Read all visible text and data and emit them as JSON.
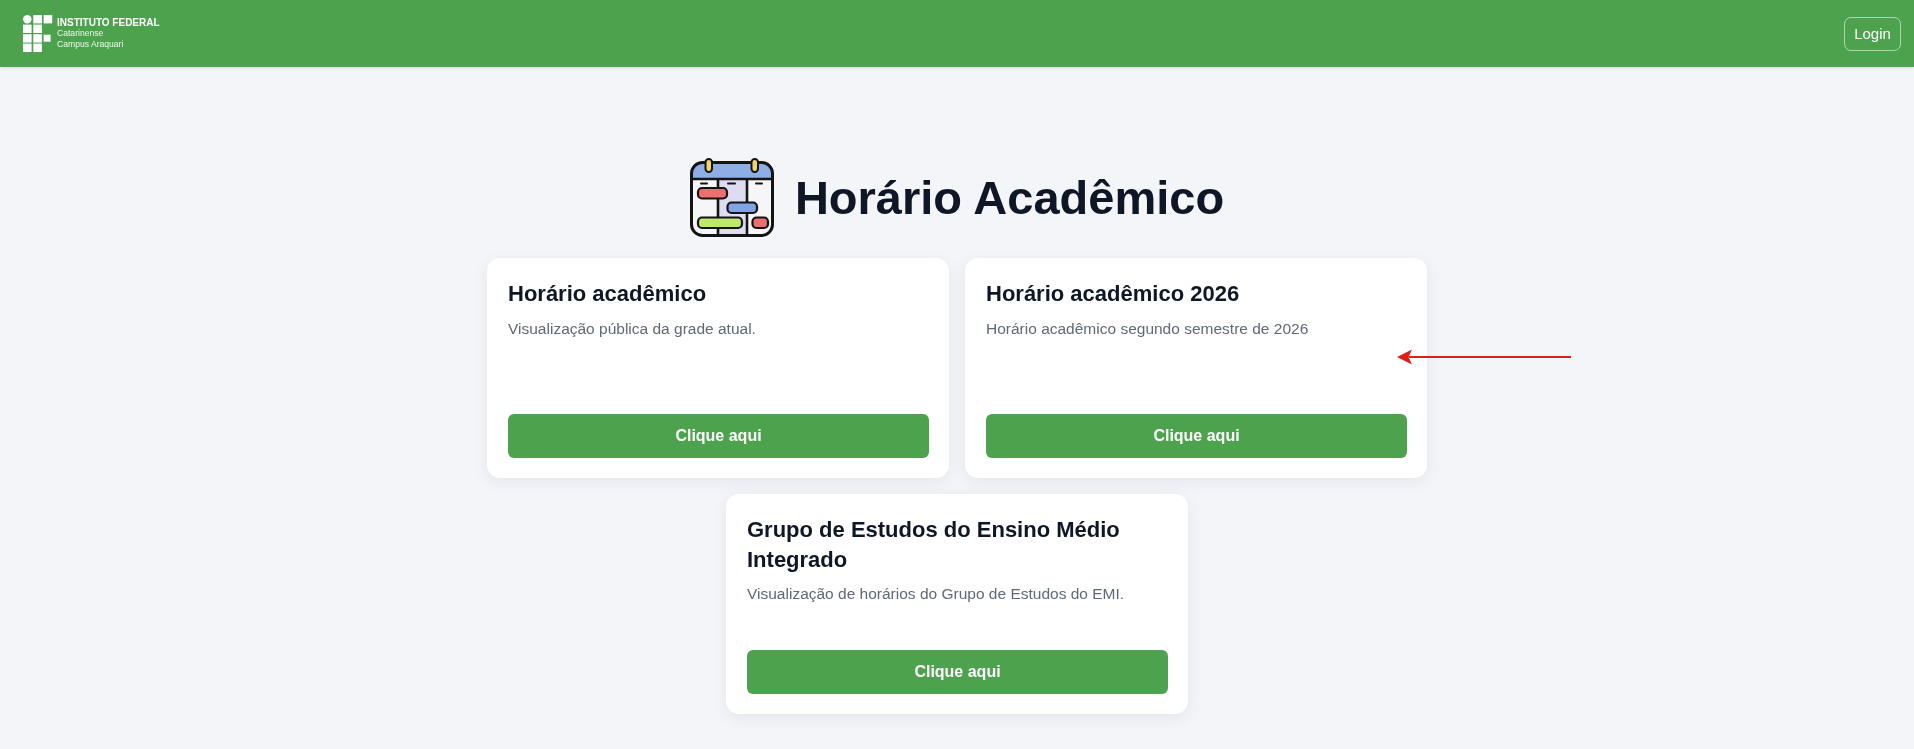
{
  "header": {
    "logo": {
      "name": "INSTITUTO FEDERAL",
      "lines": [
        "Catarinense",
        "Campus Araquari"
      ]
    },
    "login_button": "Login"
  },
  "hero": {
    "title": "Horário Acadêmico"
  },
  "cards": [
    {
      "title": "Horário acadêmico",
      "description": "Visualização pública da grade atual.",
      "button": "Clique aqui"
    },
    {
      "title": "Horário acadêmico 2026",
      "description": "Horário acadêmico segundo semestre de 2026",
      "button": "Clique aqui"
    },
    {
      "title": "Grupo de Estudos do Ensino Médio Integrado",
      "description": "Visualização de horários do Grupo de Estudos do EMI.",
      "button": "Clique aqui"
    }
  ]
}
